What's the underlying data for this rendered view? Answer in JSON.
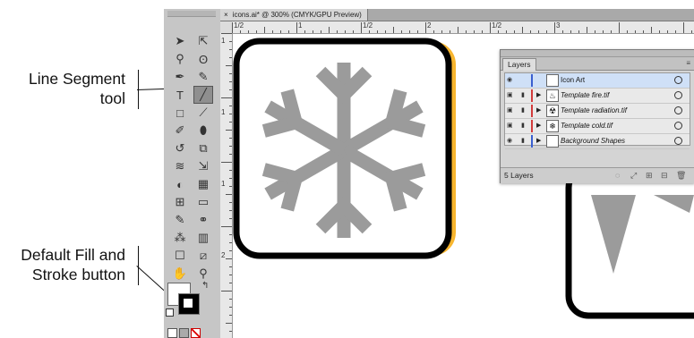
{
  "callouts": {
    "line_segment": [
      "Line Segment",
      "tool"
    ],
    "default_fill": [
      "Default Fill and",
      "Stroke button"
    ]
  },
  "document": {
    "tab_close": "×",
    "tab_title": "icons.ai* @ 300% (CMYK/GPU Preview)"
  },
  "rulers": {
    "horizontal_labels": [
      "1/2",
      "1",
      "1/2",
      "2",
      "1/2",
      "3"
    ],
    "vertical_labels": [
      "1",
      "1",
      "1",
      "2"
    ]
  },
  "toolbox": {
    "icons": [
      "selection-tool-icon",
      "direct-selection-tool-icon",
      "magic-wand-tool-icon",
      "lasso-tool-icon",
      "pen-tool-icon",
      "curvature-tool-icon",
      "type-tool-icon",
      "line-segment-tool-icon",
      "rectangle-tool-icon",
      "paintbrush-tool-icon",
      "pencil-tool-icon",
      "blob-brush-tool-icon",
      "rotate-tool-icon",
      "scale-tool-icon",
      "warp-tool-icon",
      "free-transform-tool-icon",
      "shape-builder-tool-icon",
      "perspective-grid-tool-icon",
      "mesh-tool-icon",
      "gradient-tool-icon",
      "eyedropper-tool-icon",
      "blend-tool-icon",
      "symbol-sprayer-tool-icon",
      "column-graph-tool-icon",
      "artboard-tool-icon",
      "slice-tool-icon",
      "hand-tool-icon",
      "zoom-tool-icon"
    ],
    "glyphs": [
      "➤",
      "⇱",
      "⚲",
      "ʘ",
      "✒",
      "✎",
      "T",
      "╱",
      "□",
      "⟋",
      "✐",
      "⬮",
      "↺",
      "⧉",
      "≋",
      "⇲",
      "◐",
      "▦",
      "⊞",
      "▭",
      "✎",
      "⚭",
      "⁂",
      "▥",
      "☐",
      "⧄",
      "✋",
      "⚲"
    ],
    "selected_tool": "line-segment-tool-icon"
  },
  "layers_panel": {
    "tab_label": "Layers",
    "menu_icon": "panel-menu-icon",
    "layers": [
      {
        "name": "Icon Art",
        "color": "#3a5fd0",
        "thumb": "",
        "active": true,
        "eye": "◉"
      },
      {
        "name": "Template fire.tif",
        "color": "#d23b3b",
        "thumb": "♨",
        "active": false,
        "eye": "▣"
      },
      {
        "name": "Template radiation.tif",
        "color": "#d23b3b",
        "thumb": "☢",
        "active": false,
        "eye": "▣"
      },
      {
        "name": "Template cold.tif",
        "color": "#d23b3b",
        "thumb": "❄",
        "active": false,
        "eye": "▣"
      },
      {
        "name": "Background Shapes",
        "color": "#3a5fd0",
        "thumb": "",
        "active": false,
        "eye": "◉"
      }
    ],
    "footer_count": "5 Layers",
    "footer_icons": [
      "◌",
      "⤢",
      "⊞",
      "⊟",
      "🗑"
    ]
  },
  "colors": {
    "icon_frame_orange": "#f7b52e",
    "snowflake_gray": "#9b9b9b",
    "panel_bg": "#d4d4d4"
  }
}
